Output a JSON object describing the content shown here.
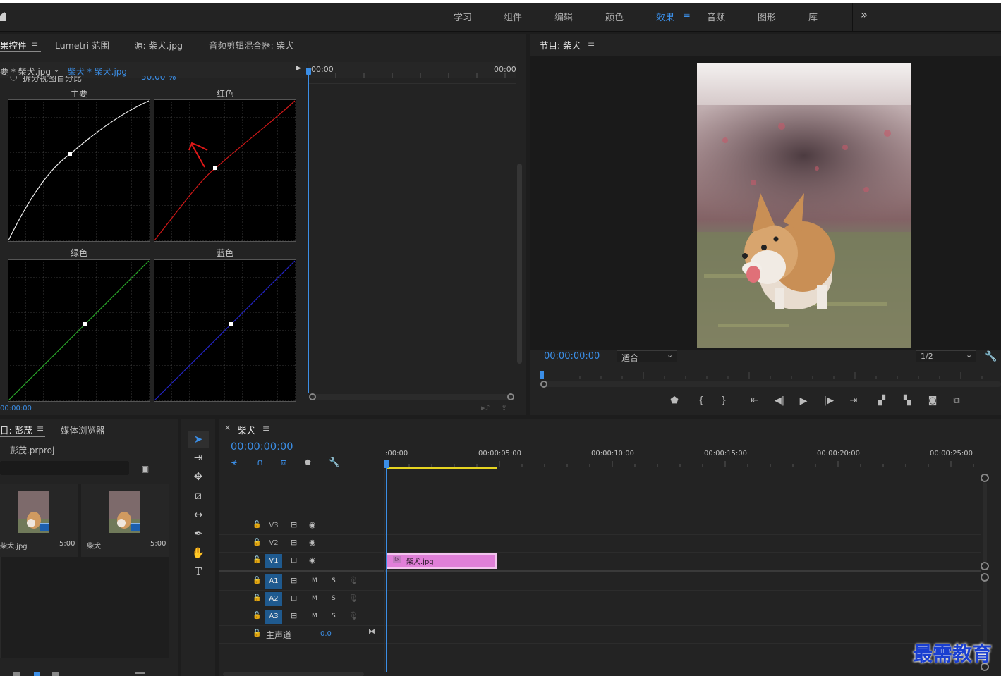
{
  "workspaces": {
    "items": [
      "学习",
      "组件",
      "编辑",
      "颜色",
      "效果",
      "音频",
      "图形",
      "库"
    ],
    "active_menu_glyph": "≡",
    "more_glyph": "»"
  },
  "effect_controls": {
    "tabs": [
      "果控件",
      "Lumetri 范围",
      "源: 柴犬.jpg",
      "音频剪辑混合器: 柴犬"
    ],
    "menu_glyph": "≡",
    "master_clip": "要 * 柴犬.jpg",
    "active_clip": "柴犬 * 柴犬.jpg",
    "partial_row_label": "拆分视图百分比",
    "partial_row_value": "50.00 %",
    "time_start": "00:00",
    "time_end": "00:00",
    "curves": [
      "主要",
      "红色",
      "绿色",
      "蓝色"
    ],
    "bottom_time": "00:00:00"
  },
  "program": {
    "title": "节目: 柴犬",
    "menu_glyph": "≡",
    "timecode": "00:00:00:00",
    "fit_label": "适合",
    "resolution": "1/2"
  },
  "project": {
    "tabs": [
      "目: 彭茂",
      "媒体浏览器"
    ],
    "menu_glyph": "≡",
    "file_name": "彭茂.prproj",
    "items": [
      {
        "name": "柴犬.jpg",
        "duration": "5:00"
      },
      {
        "name": "柴犬",
        "duration": "5:00"
      }
    ]
  },
  "timeline": {
    "close_glyph": "×",
    "title": "柴犬",
    "menu_glyph": "≡",
    "timecode": "00:00:00:00",
    "ruler": [
      ":00:00",
      "00:00:05:00",
      "00:00:10:00",
      "00:00:15:00",
      "00:00:20:00",
      "00:00:25:00"
    ],
    "video_tracks": [
      "V3",
      "V2",
      "V1"
    ],
    "audio_tracks": [
      "A1",
      "A2",
      "A3"
    ],
    "mute_label": "M",
    "solo_label": "S",
    "master_label": "主声道",
    "master_value": "0.0",
    "clip_badge": "fx",
    "clip_name": "柴犬.jpg"
  },
  "watermark": "最需教育",
  "colors": {
    "accent": "#3b8ee6",
    "clip": "#e07fd8",
    "red_curve": "#d01818",
    "green_curve": "#2aa82a",
    "blue_curve": "#2424c8",
    "annotation": "#e01818",
    "watermark": "#1a3fd0"
  }
}
